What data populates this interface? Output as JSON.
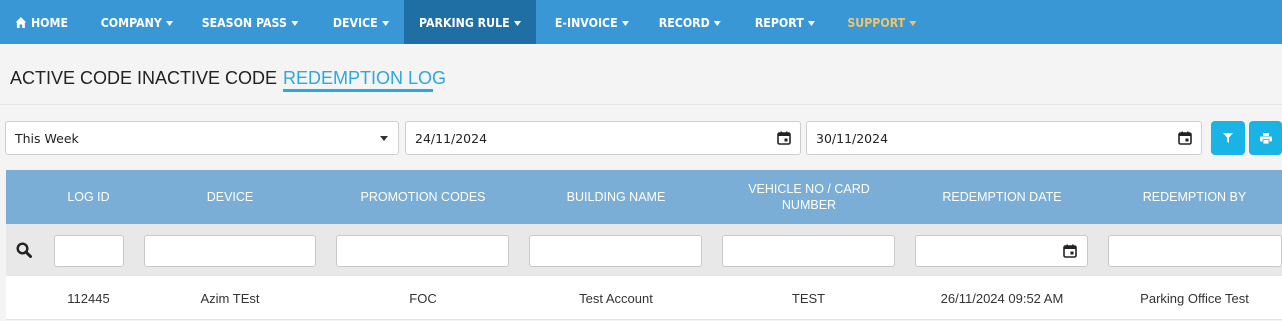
{
  "nav": {
    "home": "HOME",
    "company": "COMPANY",
    "season_pass": "SEASON PASS",
    "device": "DEVICE",
    "parking_rule": "PARKING RULE",
    "e_invoice": "E-INVOICE",
    "record": "RECORD",
    "report": "REPORT",
    "support": "SUPPORT"
  },
  "tabs": {
    "active_code": "ACTIVE CODE",
    "inactive_code": "INACTIVE CODE",
    "redemption_log": "REDEMPTION LOG"
  },
  "filters": {
    "period": "This Week",
    "date_from": "24/11/2024",
    "date_to": "30/11/2024"
  },
  "table": {
    "headers": {
      "log_id": "LOG ID",
      "device": "DEVICE",
      "promotion_codes": "PROMOTION CODES",
      "building_name": "BUILDING NAME",
      "vehicle_no": "VEHICLE NO / CARD NUMBER",
      "redemption_date": "REDEMPTION DATE",
      "redemption_by": "REDEMPTION BY"
    },
    "rows": [
      {
        "log_id": "112445",
        "device": "Azim TEst",
        "promotion_codes": "FOC",
        "building_name": "Test Account",
        "vehicle_no": "TEST",
        "redemption_date": "26/11/2024 09:52 AM",
        "redemption_by": "Parking Office Test"
      }
    ]
  },
  "icons": {
    "home": "home-icon",
    "filter": "filter-icon",
    "print": "print-icon",
    "search": "search-icon",
    "calendar": "calendar-icon"
  },
  "colors": {
    "nav_bg": "#3a97d6",
    "nav_active": "#1f6ea4",
    "support_text": "#f2c46a",
    "accent": "#29a9e0",
    "table_header": "#7aaed6",
    "button": "#19b3e6"
  }
}
